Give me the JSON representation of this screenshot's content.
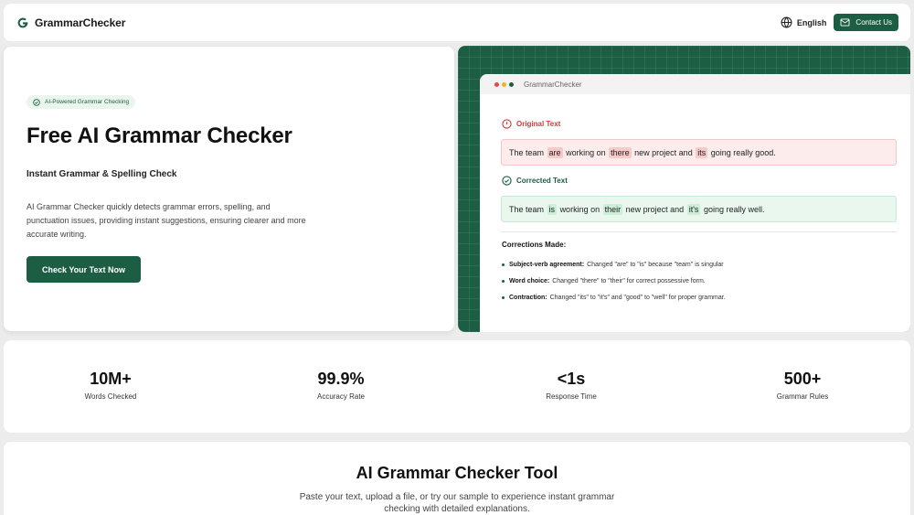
{
  "nav": {
    "brand": "GrammarChecker",
    "language": "English",
    "contact_label": "Contact Us"
  },
  "hero": {
    "badge": "AI-Powered Grammar Checking",
    "title": "Free AI Grammar Checker",
    "subtitle": "Instant Grammar & Spelling Check",
    "description": "AI Grammar Checker quickly detects grammar errors, spelling, and punctuation issues, providing instant suggestions, ensuring clearer and more accurate writing.",
    "cta_label": "Check Your Text Now"
  },
  "demo": {
    "window_title": "GrammarChecker",
    "original_label": "Original Text",
    "corrected_label": "Corrected Text",
    "original": {
      "t1": "The team",
      "e1": "are",
      "t2": "working on",
      "e2": "there",
      "t3": "new project and",
      "e3": "its",
      "t4": "going really good."
    },
    "corrected": {
      "t1": "The team",
      "c1": "is",
      "t2": "working on",
      "c2": "their",
      "t3": "new project and",
      "c3": "it's",
      "t4": "going really well."
    },
    "corrections_title": "Corrections Made:",
    "corrections": [
      {
        "title": "Subject-verb agreement:",
        "text": "Changed \"are\" to \"is\" because \"team\" is singular"
      },
      {
        "title": "Word choice:",
        "text": "Changed \"there\" to \"their\" for correct possessive form."
      },
      {
        "title": "Contraction:",
        "text": "Changed \"its\" to \"it's\" and \"good\" to \"well\" for proper grammar."
      }
    ]
  },
  "stats": [
    {
      "value": "10M+",
      "label": "Words Checked"
    },
    {
      "value": "99.9%",
      "label": "Accuracy Rate"
    },
    {
      "value": "<1s",
      "label": "Response Time"
    },
    {
      "value": "500+",
      "label": "Grammar Rules"
    }
  ],
  "tool": {
    "title": "AI Grammar Checker Tool",
    "description": "Paste your text, upload a file, or try our sample to experience instant grammar checking with detailed explanations."
  },
  "colors": {
    "brand_green": "#1b5e44",
    "error_red": "#d23a3a"
  },
  "icons": {
    "brand": "g-logo-icon",
    "language": "globe-icon",
    "contact": "mail-icon",
    "badge": "check-circle-icon",
    "original": "alert-circle-icon",
    "corrected": "check-circle-icon"
  }
}
